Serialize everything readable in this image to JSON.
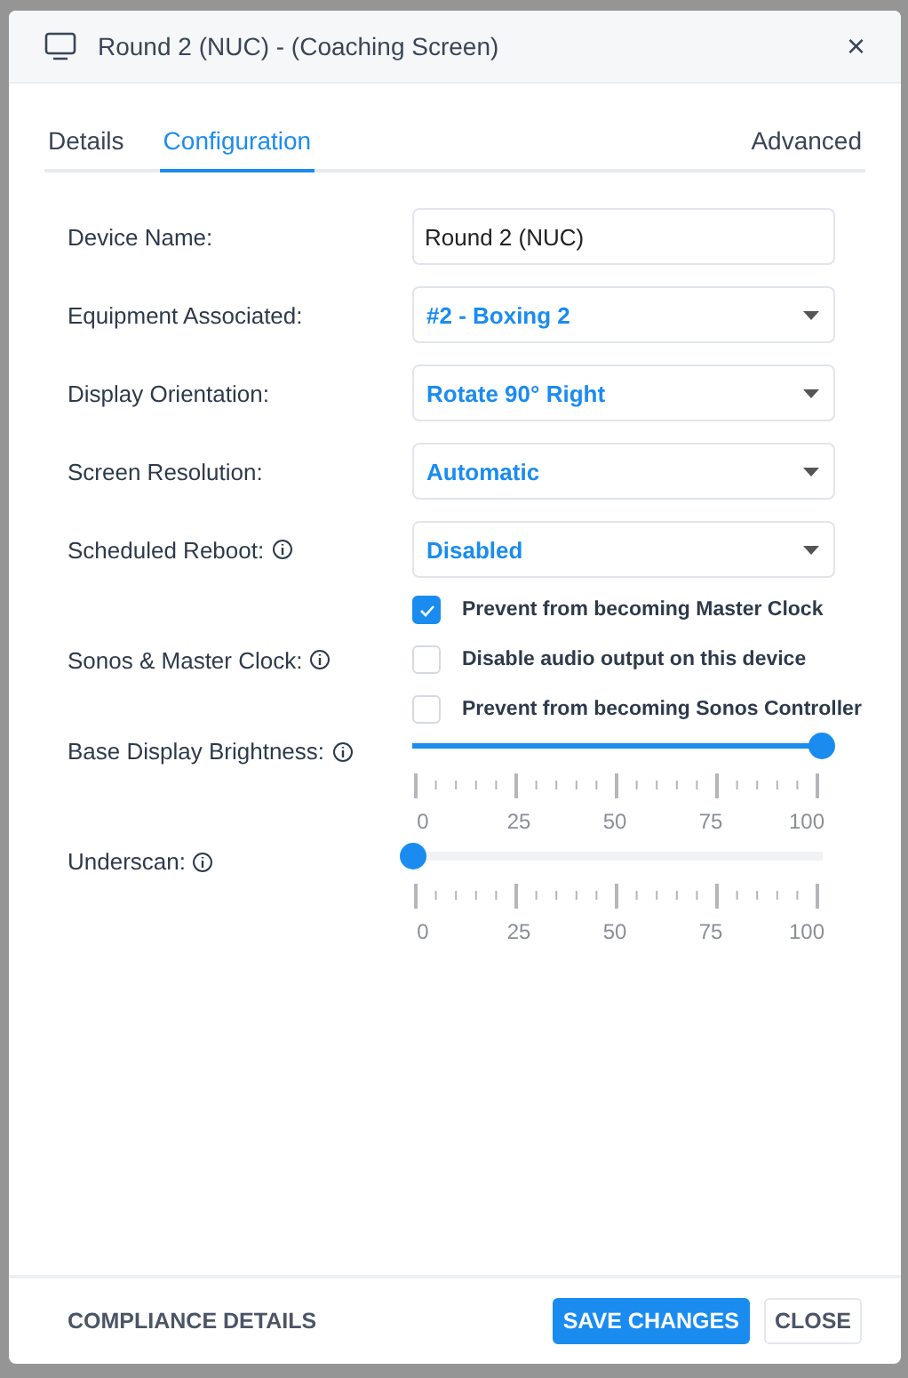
{
  "dialog": {
    "title": "Round 2 (NUC) - (Coaching Screen)",
    "close": "×"
  },
  "tabs": [
    {
      "label": "Details",
      "selected": false
    },
    {
      "label": "Configuration",
      "selected": true
    }
  ],
  "tab_right": {
    "label": "Advanced",
    "selected": false
  },
  "fields": [
    {
      "kind": "text",
      "label": "Device Name:",
      "value": "Round 2 (NUC)",
      "info": false
    },
    {
      "kind": "select",
      "label": "Equipment Associated:",
      "value": "#2 - Boxing 2",
      "info": false
    },
    {
      "kind": "select",
      "label": "Display Orientation:",
      "value": "Rotate 90° Right",
      "info": false
    },
    {
      "kind": "select",
      "label": "Screen Resolution:",
      "value": "Automatic",
      "info": false
    },
    {
      "kind": "select",
      "label": "Scheduled Reboot:",
      "value": "Disabled",
      "info": true
    }
  ],
  "sonos": {
    "label": "Sonos & Master Clock:",
    "info": true,
    "options": [
      {
        "label": "Prevent from becoming Master Clock",
        "checked": true
      },
      {
        "label": "Disable audio output on this device",
        "checked": false
      },
      {
        "label": "Prevent from becoming Sonos Controller",
        "checked": false
      }
    ]
  },
  "sliders": [
    {
      "label": "Base Display Brightness:",
      "info": true,
      "level": 1,
      "ticks": [
        "0",
        "25",
        "50",
        "75",
        "100"
      ]
    },
    {
      "label": "Underscan:",
      "info": true,
      "level": 0,
      "ticks": [
        "0",
        "25",
        "50",
        "75",
        "100"
      ]
    }
  ],
  "footer": {
    "link": "COMPLIANCE DETAILS",
    "buttons": [
      {
        "kind": "primary",
        "label": "SAVE CHANGES"
      },
      {
        "kind": "secondary",
        "label": "CLOSE"
      }
    ]
  }
}
